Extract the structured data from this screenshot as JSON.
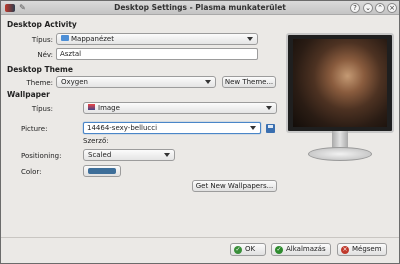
{
  "window": {
    "title": "Desktop Settings - Plasma munkaterület"
  },
  "titlebar": {
    "help_glyph": "?",
    "minimize_glyph": "⌄",
    "maximize_glyph": "⌃",
    "close_glyph": "×",
    "pin_glyph": "✎"
  },
  "activity": {
    "heading": "Desktop Activity",
    "type_label": "Típus:",
    "type_value": "Mappanézet",
    "name_label": "Név:",
    "name_value": "Asztal"
  },
  "theme": {
    "heading": "Desktop Theme",
    "theme_label": "Theme:",
    "theme_value": "Oxygen",
    "new_theme_button": "New Theme..."
  },
  "wallpaper": {
    "heading": "Wallpaper",
    "type_label": "Típus:",
    "type_value": "Image",
    "picture_label": "Picture:",
    "picture_value": "14464-sexy-bellucci",
    "author_label": "Szerző:",
    "positioning_label": "Positioning:",
    "positioning_value": "Scaled",
    "color_label": "Color:",
    "color_value": "#3d6e99",
    "get_new_button": "Get New Wallpapers..."
  },
  "footer": {
    "ok_label": "OK",
    "apply_label": "Alkalmazás",
    "cancel_label": "Mégsem"
  },
  "colors": {
    "accent": "#4a86c8",
    "ok_icon": "#3a8f3a",
    "apply_icon": "#2e8b2e",
    "cancel_icon": "#c0392b"
  }
}
